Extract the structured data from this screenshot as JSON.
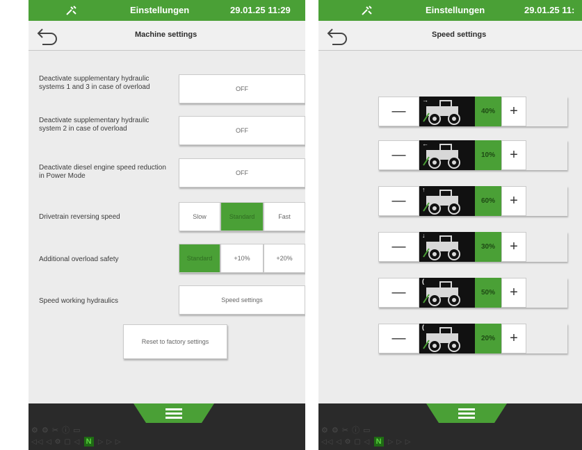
{
  "status": {
    "title": "Einstellungen",
    "time": "29.01.25 11:29",
    "time_right": "29.01.25 11:"
  },
  "left": {
    "subtitle": "Machine settings",
    "rows": [
      {
        "label": "Deactivate supplementary hydraulic systems 1 and 3 in case of overload",
        "value": "OFF"
      },
      {
        "label": "Deactivate supplementary hydraulic system 2 in case of overload",
        "value": "OFF"
      },
      {
        "label": "Deactivate diesel engine speed reduction in Power Mode",
        "value": "OFF"
      }
    ],
    "reversing": {
      "label": "Drivetrain reversing speed",
      "options": [
        "Slow",
        "Standard",
        "Fast"
      ],
      "selected": "Standard"
    },
    "overload": {
      "label": "Additional overload safety",
      "options": [
        "Standard",
        "+10%",
        "+20%"
      ],
      "selected": "Standard"
    },
    "speed_hydraulics": {
      "label": "Speed working hydraulics",
      "button": "Speed settings"
    },
    "reset_button": "Reset to factory settings"
  },
  "right": {
    "subtitle": "Speed settings",
    "rows": [
      {
        "function": "telescope-extend",
        "arrow": "→",
        "value": "40%"
      },
      {
        "function": "telescope-retract",
        "arrow": "←",
        "value": "10%"
      },
      {
        "function": "boom-raise",
        "arrow": "↑",
        "value": "60%"
      },
      {
        "function": "boom-lower",
        "arrow": "↓",
        "value": "30%"
      },
      {
        "function": "tilt-in",
        "arrow": "(",
        "value": "50%"
      },
      {
        "function": "tilt-out",
        "arrow": "(",
        "value": "20%"
      }
    ],
    "minus": "—",
    "plus": "+"
  },
  "footer": {
    "n_label": "N"
  },
  "colors": {
    "accent": "#4aa036",
    "footer": "#2a2a2a",
    "background": "#f0f0f0"
  }
}
